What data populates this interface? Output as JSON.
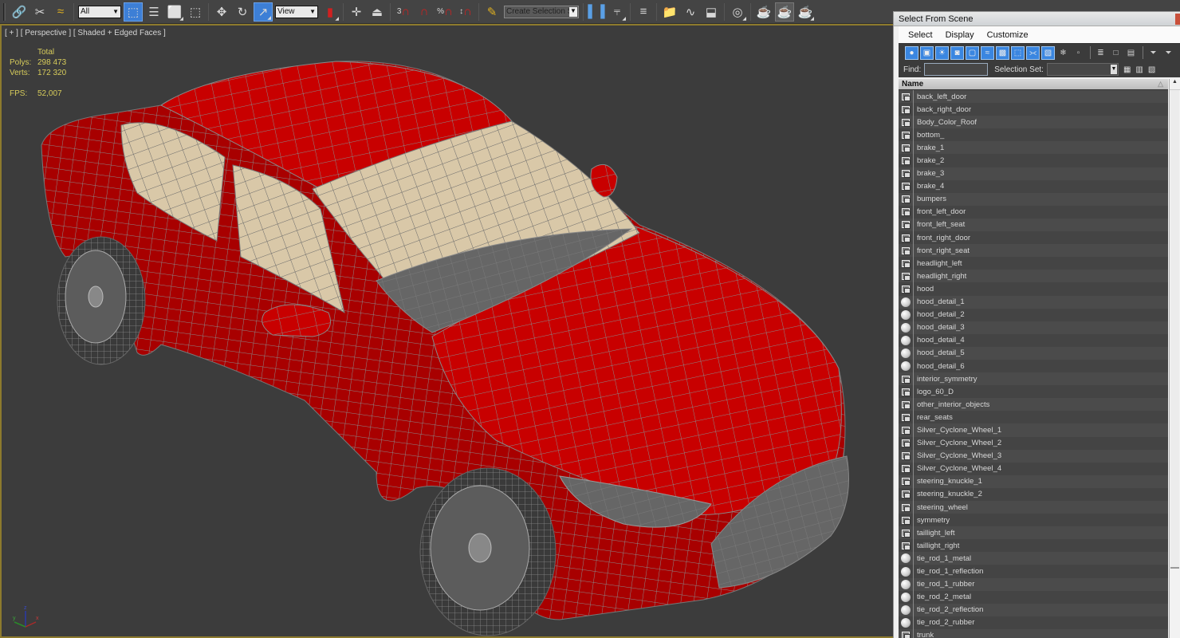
{
  "toolbar": {
    "selection_filter": "All",
    "reference_coord": "View",
    "snap_angle_label": "3",
    "named_selection_placeholder": "Create Selection Se",
    "icons": [
      "link-icon",
      "unlink-icon",
      "bind-space-warp-icon",
      "select-object-icon",
      "select-by-name-icon",
      "rect-selection-icon",
      "window-crossing-icon",
      "move-icon",
      "rotate-icon",
      "scale-icon",
      "use-pivot-center-icon",
      "select-manipulate-icon",
      "keyboard-shortcut-override-icon",
      "snaps-toggle-icon",
      "angle-snap-icon",
      "percent-snap-icon",
      "spinner-snap-icon",
      "edit-named-selection-icon",
      "mirror-icon",
      "align-icon",
      "layer-manager-icon",
      "scene-explorer-icon",
      "curve-editor-icon",
      "schematic-view-icon",
      "material-editor-icon",
      "render-setup-icon",
      "rendered-frame-window-icon",
      "render-icon"
    ]
  },
  "viewport": {
    "label_plus": "[ + ]",
    "label_view": "[ Perspective ]",
    "label_shading": "[ Shaded + Edged Faces ]",
    "stats": {
      "header": "Total",
      "polys_label": "Polys:",
      "polys_value": "298 473",
      "verts_label": "Verts:",
      "verts_value": "172 320",
      "fps_label": "FPS:",
      "fps_value": "52,007"
    },
    "axis": {
      "x": "x",
      "y": "y",
      "z": "z"
    },
    "colors": {
      "body": "#c80000",
      "wire": "#7a7a7a",
      "interior": "#d9c8a8",
      "background": "#3c3c3c",
      "frame": "#8d7a2d"
    }
  },
  "select_from_scene": {
    "title": "Select From Scene",
    "menu": [
      "Select",
      "Display",
      "Customize"
    ],
    "find_label": "Find:",
    "find_value": "",
    "selection_set_label": "Selection Set:",
    "selection_set_value": "",
    "column_header": "Name",
    "items": [
      {
        "name": "back_left_door",
        "type": "geometry"
      },
      {
        "name": "back_right_door",
        "type": "geometry"
      },
      {
        "name": "Body_Color_Roof",
        "type": "geometry"
      },
      {
        "name": "bottom_",
        "type": "geometry"
      },
      {
        "name": "brake_1",
        "type": "geometry"
      },
      {
        "name": "brake_2",
        "type": "geometry"
      },
      {
        "name": "brake_3",
        "type": "geometry"
      },
      {
        "name": "brake_4",
        "type": "geometry"
      },
      {
        "name": "bumpers",
        "type": "geometry"
      },
      {
        "name": "front_left_door",
        "type": "geometry"
      },
      {
        "name": "front_left_seat",
        "type": "geometry"
      },
      {
        "name": "front_right_door",
        "type": "geometry"
      },
      {
        "name": "front_right_seat",
        "type": "geometry"
      },
      {
        "name": "headlight_left",
        "type": "geometry"
      },
      {
        "name": "headlight_right",
        "type": "geometry"
      },
      {
        "name": "hood",
        "type": "geometry"
      },
      {
        "name": "hood_detail_1",
        "type": "sphere"
      },
      {
        "name": "hood_detail_2",
        "type": "sphere"
      },
      {
        "name": "hood_detail_3",
        "type": "sphere"
      },
      {
        "name": "hood_detail_4",
        "type": "sphere"
      },
      {
        "name": "hood_detail_5",
        "type": "sphere"
      },
      {
        "name": "hood_detail_6",
        "type": "sphere"
      },
      {
        "name": "interior_symmetry",
        "type": "geometry"
      },
      {
        "name": "logo_60_D",
        "type": "geometry"
      },
      {
        "name": "other_interior_objects",
        "type": "geometry"
      },
      {
        "name": "rear_seats",
        "type": "geometry"
      },
      {
        "name": "Silver_Cyclone_Wheel_1",
        "type": "geometry"
      },
      {
        "name": "Silver_Cyclone_Wheel_2",
        "type": "geometry"
      },
      {
        "name": "Silver_Cyclone_Wheel_3",
        "type": "geometry"
      },
      {
        "name": "Silver_Cyclone_Wheel_4",
        "type": "geometry"
      },
      {
        "name": "steering_knuckle_1",
        "type": "geometry"
      },
      {
        "name": "steering_knuckle_2",
        "type": "geometry"
      },
      {
        "name": "steering_wheel",
        "type": "geometry"
      },
      {
        "name": "symmetry",
        "type": "geometry"
      },
      {
        "name": "taillight_left",
        "type": "geometry"
      },
      {
        "name": "taillight_right",
        "type": "geometry"
      },
      {
        "name": "tie_rod_1_metal",
        "type": "sphere"
      },
      {
        "name": "tie_rod_1_reflection",
        "type": "sphere"
      },
      {
        "name": "tie_rod_1_rubber",
        "type": "sphere"
      },
      {
        "name": "tie_rod_2_metal",
        "type": "sphere"
      },
      {
        "name": "tie_rod_2_reflection",
        "type": "sphere"
      },
      {
        "name": "tie_rod_2_rubber",
        "type": "sphere"
      },
      {
        "name": "trunk",
        "type": "geometry"
      }
    ]
  }
}
